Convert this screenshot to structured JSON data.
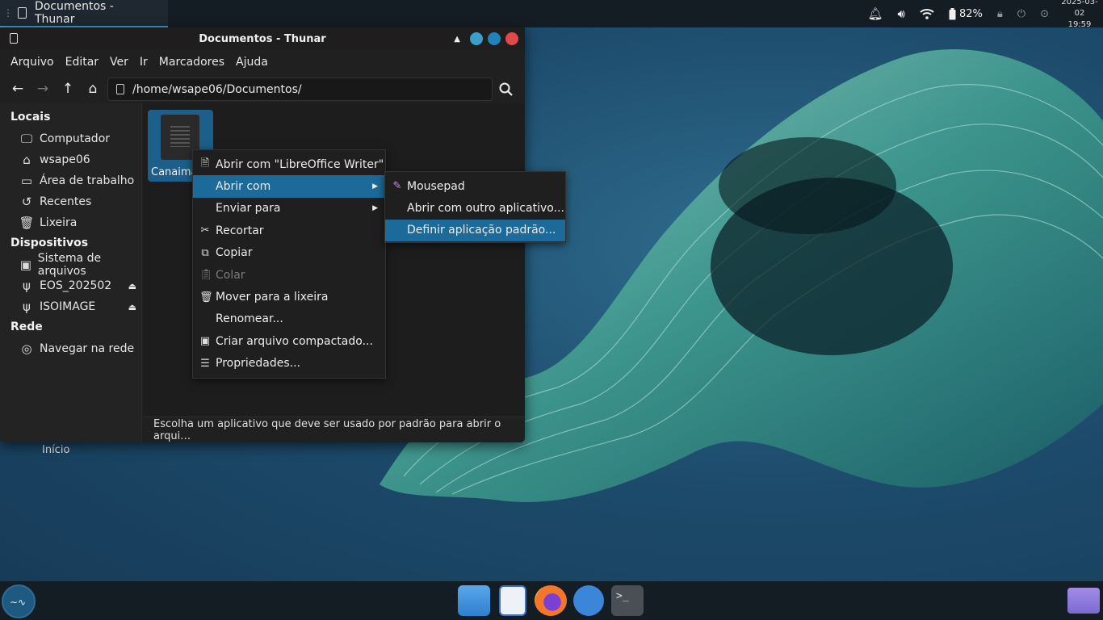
{
  "top_panel": {
    "task_title": "Documentos - Thunar",
    "battery": "82%",
    "date": "2025-03-02",
    "time": "19:59"
  },
  "window": {
    "title": "Documentos - Thunar",
    "menus": [
      "Arquivo",
      "Editar",
      "Ver",
      "Ir",
      "Marcadores",
      "Ajuda"
    ],
    "location": "/home/wsape06/Documentos/",
    "status": "Escolha um aplicativo que deve ser usado por padrão para abrir o arqui…"
  },
  "sidebar": {
    "locais_title": "Locais",
    "locais": [
      "Computador",
      "wsape06",
      "Área de trabalho",
      "Recentes",
      "Lixeira"
    ],
    "dispositivos_title": "Dispositivos",
    "dispositivos": [
      "Sistema de arquivos",
      "EOS_202502",
      "ISOIMAGE"
    ],
    "rede_title": "Rede",
    "rede": [
      "Navegar na rede"
    ]
  },
  "file": {
    "name": "Canaima"
  },
  "context_menu": [
    "Abrir com \"LibreOffice Writer\"",
    "Abrir com",
    "Enviar para",
    "Recortar",
    "Copiar",
    "Colar",
    "Mover para a lixeira",
    "Renomear...",
    "Criar arquivo compactado...",
    "Propriedades..."
  ],
  "submenu": [
    "Mousepad",
    "Abrir com outro aplicativo...",
    "Definir aplicação padrão..."
  ],
  "desktop": {
    "label": "Início"
  },
  "colors": {
    "accent": "#1b6a9a",
    "panel": "#151d24",
    "window_bg": "#202020"
  }
}
